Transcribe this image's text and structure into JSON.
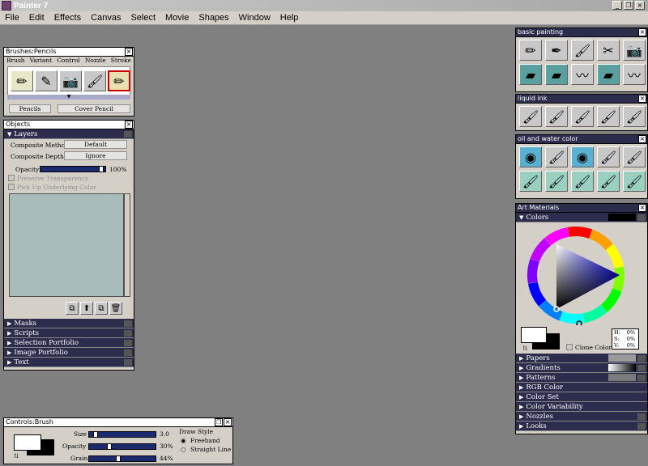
{
  "app": {
    "title": "Painter 7"
  },
  "menu": [
    "File",
    "Edit",
    "Effects",
    "Canvas",
    "Select",
    "Movie",
    "Shapes",
    "Window",
    "Help"
  ],
  "brushes": {
    "title": "Brushes:Pencils",
    "tabs": [
      "Brush",
      "Variant",
      "Control",
      "Nozzle",
      "Stroke"
    ],
    "category": "Pencils",
    "variant": "Cover Pencil"
  },
  "objects": {
    "title": "Objects",
    "layers_label": "Layers",
    "composite_method_label": "Composite Method",
    "composite_method_value": "Default",
    "composite_depth_label": "Composite Depth",
    "composite_depth_value": "Ignore",
    "opacity_label": "Opacity",
    "opacity_value": "100%",
    "opacity_level": 1.0,
    "preserve_transparency": "Preserve Transparency",
    "pick_up_underlying": "Pick Up Underlying Color",
    "sections": [
      "Masks",
      "Scripts",
      "Selection Portfolio",
      "Image Portfolio",
      "Text"
    ]
  },
  "controls": {
    "title": "Controls:Brush",
    "size_label": "Size",
    "size_value": "3.0",
    "size_level": 0.07,
    "opacity_label": "Opacity",
    "opacity_value": "30%",
    "opacity_level": 0.3,
    "grain_label": "Grain",
    "grain_value": "44%",
    "grain_level": 0.44,
    "draw_style_label": "Draw Style",
    "freehand": "Freehand",
    "straight": "Straight Line"
  },
  "palettes": {
    "basic_painting": "basic painting",
    "liquid_ink": "liquid ink",
    "oil_water": "oil and water color"
  },
  "art": {
    "title": "Art Materials",
    "colors_label": "Colors",
    "h_label": "H:",
    "h_value": "0%",
    "s_label": "S:",
    "s_value": "0%",
    "v_label": "V:",
    "v_value": "0%",
    "clone_color": "Clone Color",
    "sections": [
      "Papers",
      "Gradients",
      "Patterns",
      "RGB Color",
      "Color Set",
      "Color Variability",
      "Nozzles",
      "Looks"
    ]
  },
  "colors": {
    "desktop": "#808080",
    "panel": "#d4d0c8",
    "bar": "#2c2c4c"
  }
}
